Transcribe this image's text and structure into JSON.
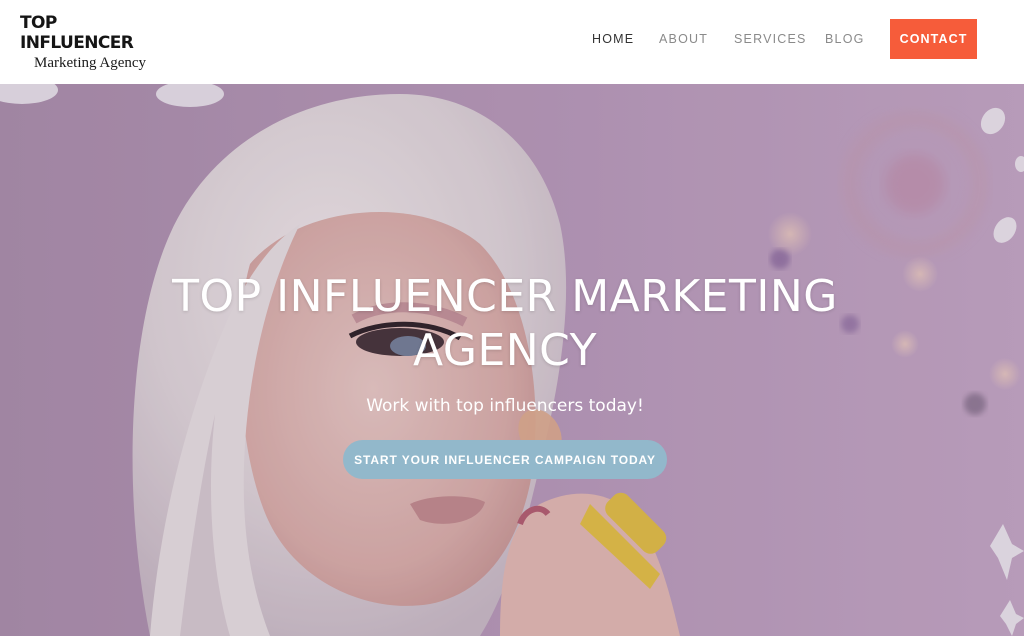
{
  "header": {
    "logo": {
      "title": "TOP INFLUENCER",
      "subtitle": "Marketing Agency"
    },
    "nav": {
      "items": [
        {
          "label": "HOME",
          "active": true
        },
        {
          "label": "ABOUT",
          "active": false
        },
        {
          "label": "SERVICES",
          "active": false
        },
        {
          "label": "BLOG",
          "active": false
        }
      ],
      "contact_label": "CONTACT"
    }
  },
  "hero": {
    "title": "TOP INFLUENCER MARKETING AGENCY",
    "subtitle": "Work with top influencers today!",
    "cta_label": "START YOUR INFLUENCER CAMPAIGN TODAY",
    "image_icon": "photo-woman-makeup-brush"
  },
  "colors": {
    "accent": "#f65c3a",
    "cta": "#92b8cb",
    "nav_active": "#333333",
    "nav_inactive": "#8a8a8a",
    "hero_tint": "#b89bb6"
  }
}
